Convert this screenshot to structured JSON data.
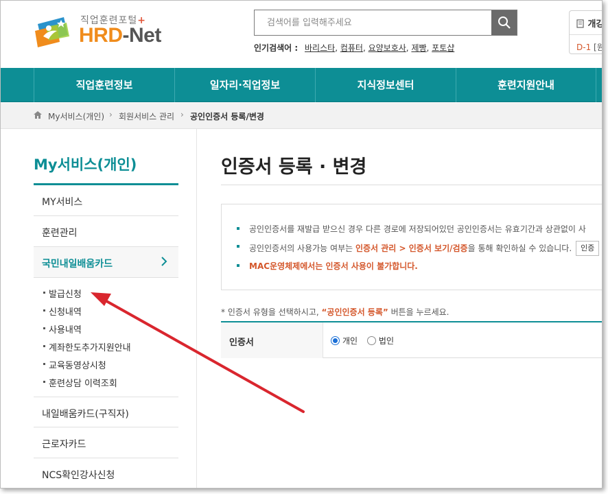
{
  "header": {
    "logo_sub": "직업훈련포털",
    "logo_plus": "+",
    "logo_hrd": "HRD",
    "logo_net": "-Net",
    "search_placeholder": "검색어를 입력해주세요",
    "popular_label": "인기검색어 :",
    "popular_keywords": [
      "바리스타",
      "컴퓨터",
      "요양보호사",
      "제빵",
      "포토샵"
    ],
    "widget_title": "개강",
    "widget_dday": "D-1",
    "widget_rest": "[원"
  },
  "gnb": {
    "items": [
      "직업훈련정보",
      "일자리·직업정보",
      "지식정보센터",
      "훈련지원안내"
    ]
  },
  "breadcrumb": {
    "items": [
      "My서비스(개인)",
      "회원서비스 관리",
      "공인인증서 등록/변경"
    ]
  },
  "lnb": {
    "title": "My서비스(개인)",
    "items": [
      "MY서비스",
      "훈련관리",
      "국민내일배움카드"
    ],
    "sub_items": [
      "발급신청",
      "신청내역",
      "사용내역",
      "계좌한도추가지원안내",
      "교육동영상시청",
      "훈련상담 이력조회"
    ],
    "items_after": [
      "내일배움카드(구직자)",
      "근로자카드",
      "NCS확인강사신청"
    ]
  },
  "content": {
    "title": "인증서 등록 · 변경",
    "notice": {
      "line1": "공인인증서를 재발급 받으신 경우 다른 경로에 저장되어있던 공인인증서는 유효기간과 상관없이 사",
      "line2_pre": "공인인증서의 사용가능 여부는 ",
      "line2_emph": "인증서 관리 > 인증서 보기/검증",
      "line2_post": "을 통해 확인하실 수 있습니다.",
      "line2_btn": "인증",
      "line3": "MAC운영체제에서는 인증서 사용이 불가합니다."
    },
    "instruction_pre": "* 인증서 유형을 선택하시고, ",
    "instruction_q": "“공인인증서 등록”",
    "instruction_post": " 버튼을 누르세요.",
    "form_label": "인증서",
    "radio_personal": "개인",
    "radio_corporate": "법인",
    "radio_selected": "개인"
  },
  "colors": {
    "brand_teal": "#0d8e95",
    "accent_orange": "#d4572b",
    "logo_orange": "#f08c1c",
    "annotation_red": "#d9262e"
  }
}
